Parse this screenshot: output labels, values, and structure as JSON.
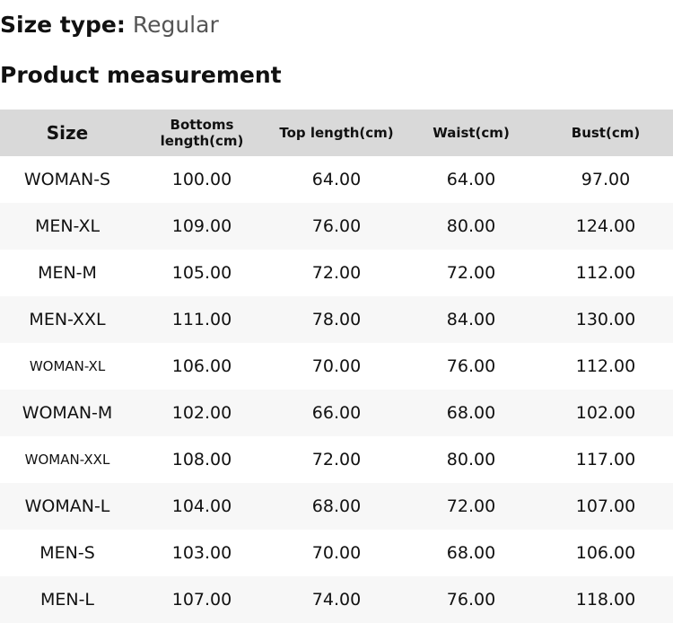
{
  "size_type": {
    "label": "Size type:",
    "value": "Regular"
  },
  "section_title": "Product measurement",
  "table": {
    "headers": [
      "Size",
      "Bottoms length(cm)",
      "Top length(cm)",
      "Waist(cm)",
      "Bust(cm)"
    ],
    "rows": [
      [
        "WOMAN-S",
        "100.00",
        "64.00",
        "64.00",
        "97.00"
      ],
      [
        "MEN-XL",
        "109.00",
        "76.00",
        "80.00",
        "124.00"
      ],
      [
        "MEN-M",
        "105.00",
        "72.00",
        "72.00",
        "112.00"
      ],
      [
        "MEN-XXL",
        "111.00",
        "78.00",
        "84.00",
        "130.00"
      ],
      [
        "WOMAN-XL",
        "106.00",
        "70.00",
        "76.00",
        "112.00"
      ],
      [
        "WOMAN-M",
        "102.00",
        "66.00",
        "68.00",
        "102.00"
      ],
      [
        "WOMAN-XXL",
        "108.00",
        "72.00",
        "80.00",
        "117.00"
      ],
      [
        "WOMAN-L",
        "104.00",
        "68.00",
        "72.00",
        "107.00"
      ],
      [
        "MEN-S",
        "103.00",
        "70.00",
        "68.00",
        "106.00"
      ],
      [
        "MEN-L",
        "107.00",
        "74.00",
        "76.00",
        "118.00"
      ]
    ]
  },
  "colors": {
    "header_background": "#d9d9d9",
    "alternate_row_background": "#f7f7f7",
    "text": "#111111",
    "muted_text": "#555555"
  }
}
